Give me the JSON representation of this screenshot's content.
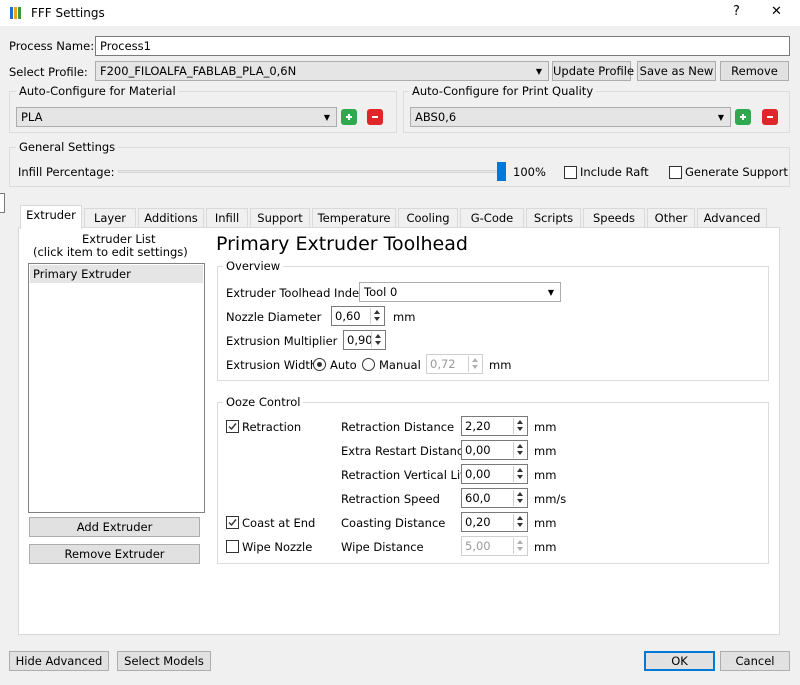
{
  "window": {
    "title": "FFF Settings",
    "help_label": "?",
    "close_label": "✕"
  },
  "process": {
    "label": "Process Name:",
    "value": "Process1"
  },
  "profile": {
    "label": "Select Profile:",
    "value": "F200_FILOALFA_FABLAB_PLA_0,6N",
    "update_label": "Update Profile",
    "save_label": "Save as New",
    "remove_label": "Remove"
  },
  "material": {
    "group_label": "Auto-Configure for Material",
    "value": "PLA"
  },
  "quality": {
    "group_label": "Auto-Configure for Print Quality",
    "value": "ABS0,6"
  },
  "general": {
    "group_label": "General Settings",
    "infill_label": "Infill Percentage:",
    "infill_value": "100%",
    "infill_fraction": 1.0,
    "raft_label": "Include Raft",
    "support_label": "Generate Support"
  },
  "tabs": [
    "Extruder",
    "Layer",
    "Additions",
    "Infill",
    "Support",
    "Temperature",
    "Cooling",
    "G-Code",
    "Scripts",
    "Speeds",
    "Other",
    "Advanced"
  ],
  "extruder_list": {
    "title_line1": "Extruder List",
    "title_line2": "(click item to edit settings)",
    "items": [
      "Primary Extruder"
    ],
    "add_label": "Add Extruder",
    "remove_label": "Remove Extruder"
  },
  "toolhead": {
    "title": "Primary Extruder Toolhead",
    "overview_label": "Overview",
    "index_label": "Extruder Toolhead Index",
    "index_value": "Tool 0",
    "nozzle_label": "Nozzle Diameter",
    "nozzle_value": "0,60",
    "nozzle_unit": "mm",
    "multiplier_label": "Extrusion Multiplier",
    "multiplier_value": "0,90",
    "width_label": "Extrusion Width",
    "width_auto_label": "Auto",
    "width_manual_label": "Manual",
    "width_value": "0,72",
    "width_unit": "mm"
  },
  "ooze": {
    "group_label": "Ooze Control",
    "retraction_label": "Retraction",
    "coast_label": "Coast at End",
    "wipe_label": "Wipe Nozzle",
    "fields": [
      {
        "label": "Retraction Distance",
        "value": "2,20",
        "unit": "mm"
      },
      {
        "label": "Extra Restart Distance",
        "value": "0,00",
        "unit": "mm"
      },
      {
        "label": "Retraction Vertical Lift",
        "value": "0,00",
        "unit": "mm"
      },
      {
        "label": "Retraction Speed",
        "value": "60,0",
        "unit": "mm/s"
      },
      {
        "label": "Coasting Distance",
        "value": "0,20",
        "unit": "mm"
      },
      {
        "label": "Wipe Distance",
        "value": "5,00",
        "unit": "mm"
      }
    ]
  },
  "footer": {
    "hide_advanced_label": "Hide Advanced",
    "select_models_label": "Select Models",
    "ok_label": "OK",
    "cancel_label": "Cancel"
  },
  "colors": {
    "add": "#2fa84f",
    "remove": "#e0262b",
    "slider": "#0078d7"
  }
}
